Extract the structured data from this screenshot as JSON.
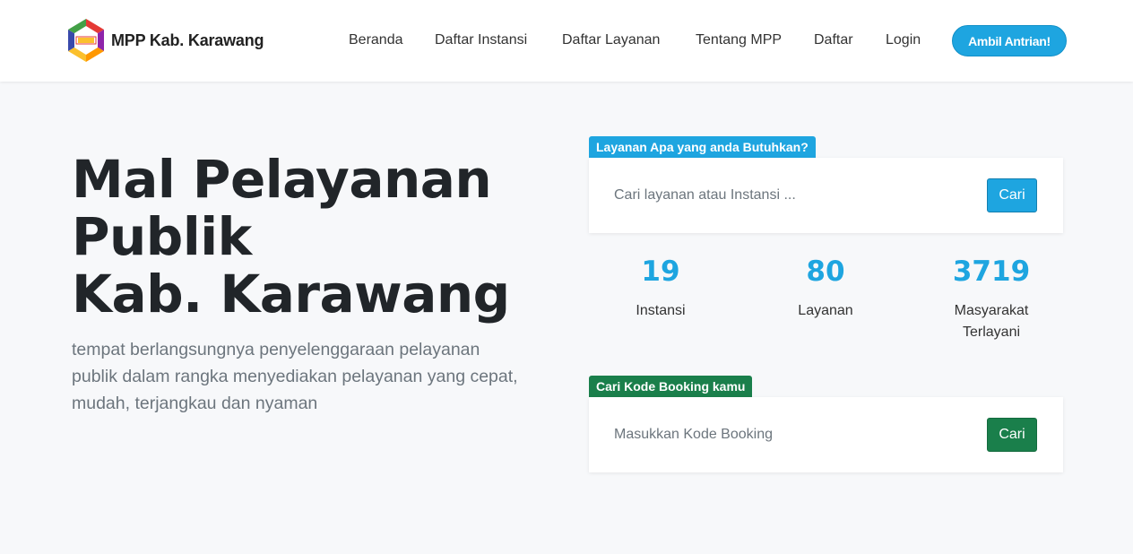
{
  "brand": {
    "name": "MPP Kab. Karawang"
  },
  "nav": {
    "items": [
      "Beranda",
      "Daftar Instansi",
      "Daftar Layanan",
      "Tentang MPP",
      "Daftar",
      "Login"
    ],
    "cta_label": "Ambil Antrian!"
  },
  "hero": {
    "title_lines": [
      "Mal Pelayanan",
      "Publik",
      "Kab. Karawang"
    ],
    "subtitle": "tempat berlangsungnya penyelenggaraan pelayanan publik dalam rangka menyediakan pelayanan yang cepat, mudah, terjangkau dan nyaman"
  },
  "search": {
    "tag": "Layanan Apa yang anda Butuhkan?",
    "placeholder": "Cari layanan atau Instansi ...",
    "value": "",
    "button_label": "Cari"
  },
  "stats": [
    {
      "number": "19",
      "label": "Instansi"
    },
    {
      "number": "80",
      "label": "Layanan"
    },
    {
      "number": "3719",
      "label": "Masyarakat Terlayani"
    }
  ],
  "booking": {
    "tag": "Cari Kode Booking kamu",
    "placeholder": "Masukkan Kode Booking",
    "value": "",
    "button_label": "Cari"
  },
  "colors": {
    "primary": "#1ea5e0",
    "success": "#1a7f4b",
    "background": "#f7f8fa",
    "heading": "#212529",
    "muted": "#6c757d"
  }
}
